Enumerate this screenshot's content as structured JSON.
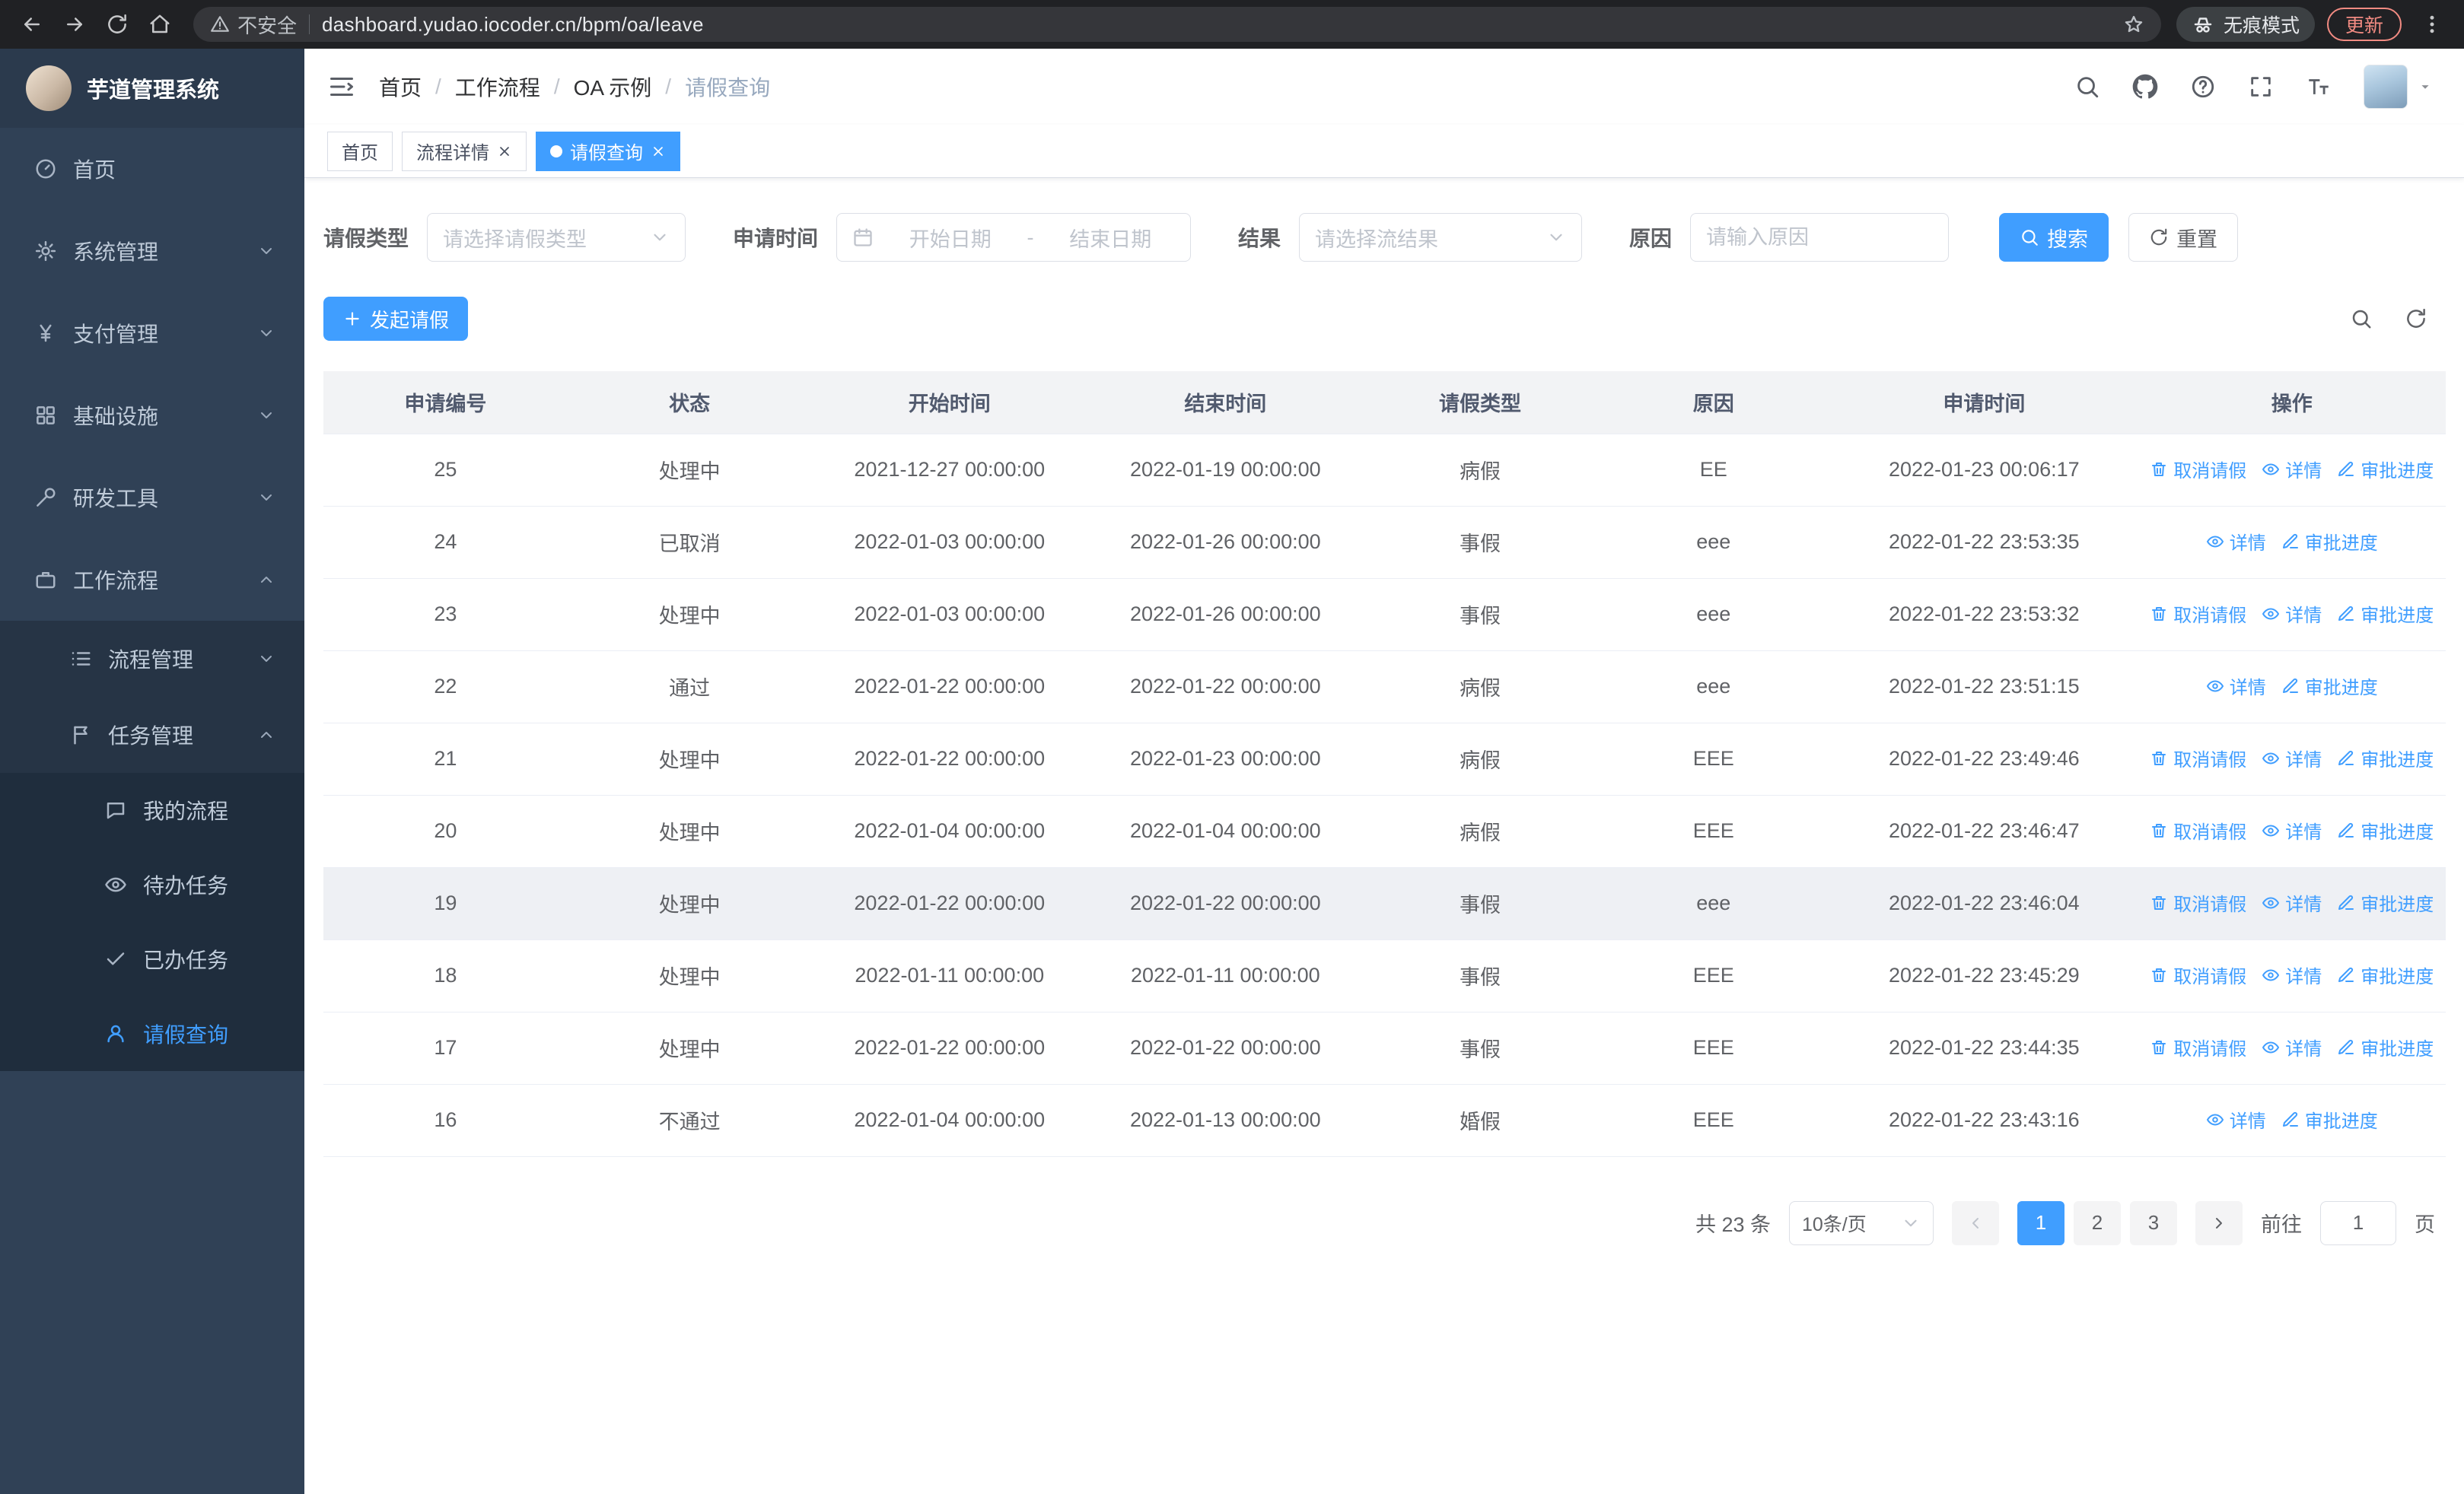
{
  "browser": {
    "security_label": "不安全",
    "url": "dashboard.yudao.iocoder.cn/bpm/oa/leave",
    "incognito_label": "无痕模式",
    "update_label": "更新"
  },
  "app": {
    "title": "芋道管理系统"
  },
  "sidebar": {
    "items": [
      {
        "name": "home",
        "icon": "dashboard-icon",
        "label": "首页",
        "level": 0
      },
      {
        "name": "system-management",
        "icon": "gear-icon",
        "label": "系统管理",
        "level": 0,
        "arrow": "down"
      },
      {
        "name": "payment-management",
        "icon": "yen-icon",
        "label": "支付管理",
        "level": 0,
        "arrow": "down"
      },
      {
        "name": "infrastructure",
        "icon": "grid-icon",
        "label": "基础设施",
        "level": 0,
        "arrow": "down"
      },
      {
        "name": "dev-tools",
        "icon": "tools-icon",
        "label": "研发工具",
        "level": 0,
        "arrow": "down"
      },
      {
        "name": "workflow",
        "icon": "briefcase-icon",
        "label": "工作流程",
        "level": 0,
        "arrow": "up"
      },
      {
        "name": "process-management",
        "icon": "list-icon",
        "label": "流程管理",
        "level": 1,
        "arrow": "down"
      },
      {
        "name": "task-management",
        "icon": "flag-icon",
        "label": "任务管理",
        "level": 1,
        "arrow": "up"
      },
      {
        "name": "my-process",
        "icon": "chat-icon",
        "label": "我的流程",
        "level": 2
      },
      {
        "name": "todo-tasks",
        "icon": "eye-icon",
        "label": "待办任务",
        "level": 2
      },
      {
        "name": "done-tasks",
        "icon": "check-icon",
        "label": "已办任务",
        "level": 2
      },
      {
        "name": "leave-query",
        "icon": "user-icon",
        "label": "请假查询",
        "level": 2,
        "active": true
      }
    ]
  },
  "breadcrumb": [
    "首页",
    "工作流程",
    "OA 示例",
    "请假查询"
  ],
  "tabs": [
    {
      "name": "home",
      "label": "首页",
      "closable": false,
      "active": false
    },
    {
      "name": "process-detail",
      "label": "流程详情",
      "closable": true,
      "active": false
    },
    {
      "name": "leave-query",
      "label": "请假查询",
      "closable": true,
      "active": true
    }
  ],
  "filters": {
    "leave_type": {
      "label": "请假类型",
      "placeholder": "请选择请假类型"
    },
    "apply_time": {
      "label": "申请时间",
      "start_placeholder": "开始日期",
      "separator": "-",
      "end_placeholder": "结束日期"
    },
    "result": {
      "label": "结果",
      "placeholder": "请选择流结果"
    },
    "reason": {
      "label": "原因",
      "placeholder": "请输入原因"
    },
    "search_label": "搜索",
    "reset_label": "重置"
  },
  "toolbar": {
    "create_label": "发起请假"
  },
  "table": {
    "columns": [
      "申请编号",
      "状态",
      "开始时间",
      "结束时间",
      "请假类型",
      "原因",
      "申请时间",
      "操作"
    ],
    "action_labels": {
      "cancel": "取消请假",
      "detail": "详情",
      "progress": "审批进度"
    },
    "rows": [
      {
        "id": "25",
        "status": "处理中",
        "start": "2021-12-27 00:00:00",
        "end": "2022-01-19 00:00:00",
        "type": "病假",
        "reason": "EE",
        "apply_time": "2022-01-23 00:06:17",
        "actions": [
          "cancel",
          "detail",
          "progress"
        ],
        "highlighted": false
      },
      {
        "id": "24",
        "status": "已取消",
        "start": "2022-01-03 00:00:00",
        "end": "2022-01-26 00:00:00",
        "type": "事假",
        "reason": "eee",
        "apply_time": "2022-01-22 23:53:35",
        "actions": [
          "detail",
          "progress"
        ],
        "highlighted": false
      },
      {
        "id": "23",
        "status": "处理中",
        "start": "2022-01-03 00:00:00",
        "end": "2022-01-26 00:00:00",
        "type": "事假",
        "reason": "eee",
        "apply_time": "2022-01-22 23:53:32",
        "actions": [
          "cancel",
          "detail",
          "progress"
        ],
        "highlighted": false
      },
      {
        "id": "22",
        "status": "通过",
        "start": "2022-01-22 00:00:00",
        "end": "2022-01-22 00:00:00",
        "type": "病假",
        "reason": "eee",
        "apply_time": "2022-01-22 23:51:15",
        "actions": [
          "detail",
          "progress"
        ],
        "highlighted": false
      },
      {
        "id": "21",
        "status": "处理中",
        "start": "2022-01-22 00:00:00",
        "end": "2022-01-23 00:00:00",
        "type": "病假",
        "reason": "EEE",
        "apply_time": "2022-01-22 23:49:46",
        "actions": [
          "cancel",
          "detail",
          "progress"
        ],
        "highlighted": false
      },
      {
        "id": "20",
        "status": "处理中",
        "start": "2022-01-04 00:00:00",
        "end": "2022-01-04 00:00:00",
        "type": "病假",
        "reason": "EEE",
        "apply_time": "2022-01-22 23:46:47",
        "actions": [
          "cancel",
          "detail",
          "progress"
        ],
        "highlighted": false
      },
      {
        "id": "19",
        "status": "处理中",
        "start": "2022-01-22 00:00:00",
        "end": "2022-01-22 00:00:00",
        "type": "事假",
        "reason": "eee",
        "apply_time": "2022-01-22 23:46:04",
        "actions": [
          "cancel",
          "detail",
          "progress"
        ],
        "highlighted": true
      },
      {
        "id": "18",
        "status": "处理中",
        "start": "2022-01-11 00:00:00",
        "end": "2022-01-11 00:00:00",
        "type": "事假",
        "reason": "EEE",
        "apply_time": "2022-01-22 23:45:29",
        "actions": [
          "cancel",
          "detail",
          "progress"
        ],
        "highlighted": false
      },
      {
        "id": "17",
        "status": "处理中",
        "start": "2022-01-22 00:00:00",
        "end": "2022-01-22 00:00:00",
        "type": "事假",
        "reason": "EEE",
        "apply_time": "2022-01-22 23:44:35",
        "actions": [
          "cancel",
          "detail",
          "progress"
        ],
        "highlighted": false
      },
      {
        "id": "16",
        "status": "不通过",
        "start": "2022-01-04 00:00:00",
        "end": "2022-01-13 00:00:00",
        "type": "婚假",
        "reason": "EEE",
        "apply_time": "2022-01-22 23:43:16",
        "actions": [
          "detail",
          "progress"
        ],
        "highlighted": false
      }
    ]
  },
  "pagination": {
    "total_text": "共 23 条",
    "page_size_label": "10条/页",
    "pages": [
      "1",
      "2",
      "3"
    ],
    "active_page": "1",
    "goto_prefix": "前往",
    "goto_value": "1",
    "goto_suffix": "页"
  },
  "colors": {
    "accent": "#409eff",
    "sidebar_bg": "#304156",
    "submenu_bg": "#1f2d3d",
    "update_accent": "#f28b82"
  }
}
